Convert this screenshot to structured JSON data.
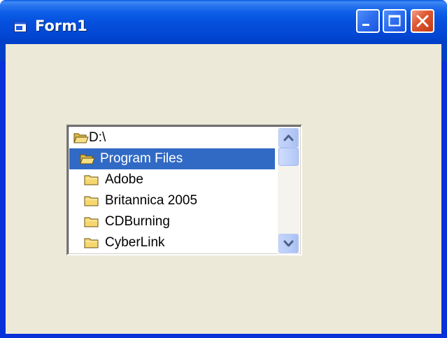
{
  "window": {
    "title": "Form1",
    "controls": {
      "minimize": "minimize",
      "maximize": "maximize",
      "close": "close"
    }
  },
  "dir_list": {
    "items": [
      {
        "label": "D:\\",
        "icon": "open-folder-icon",
        "indent": 0,
        "selected": false
      },
      {
        "label": "Program Files",
        "icon": "open-folder-icon",
        "indent": 1,
        "selected": true
      },
      {
        "label": "Adobe",
        "icon": "folder-icon",
        "indent": 2,
        "selected": false
      },
      {
        "label": "Britannica 2005",
        "icon": "folder-icon",
        "indent": 2,
        "selected": false
      },
      {
        "label": "CDBurning",
        "icon": "folder-icon",
        "indent": 2,
        "selected": false
      },
      {
        "label": "CyberLink",
        "icon": "folder-icon",
        "indent": 2,
        "selected": false
      }
    ]
  },
  "colors": {
    "titlebar": "#0348d5",
    "client_bg": "#ece9d8",
    "selection": "#316ac5",
    "folder_yellow": "#f5d76e"
  }
}
